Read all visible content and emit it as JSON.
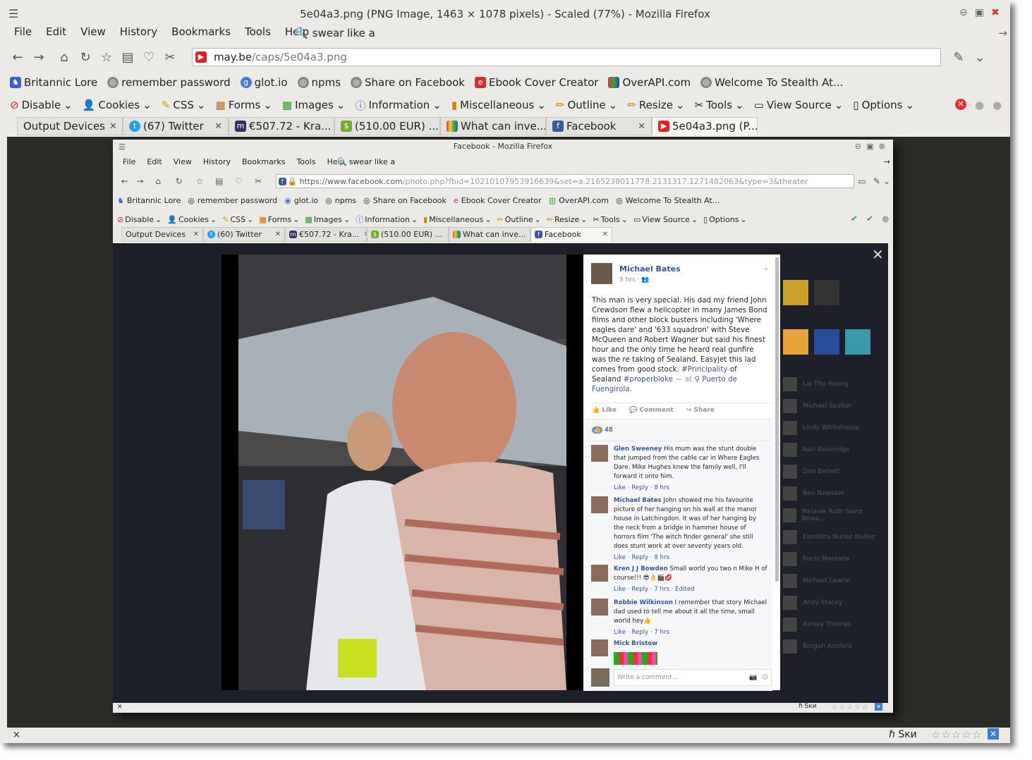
{
  "outer": {
    "title": "5e04a3.png (PNG Image, 1463 × 1078 pixels) - Scaled (77%) - Mozilla Firefox",
    "menu": [
      "File",
      "Edit",
      "View",
      "History",
      "Bookmarks",
      "Tools",
      "Help"
    ],
    "search_value": "swear like a",
    "url": "may.be/caps/5e04a3.png",
    "url_host": "may.be",
    "url_path": "/caps/5e04a3.png",
    "bookmarks": [
      "Britannic Lore",
      "remember password",
      "glot.io",
      "npms",
      "Share on Facebook",
      "Ebook Cover Creator",
      "OverAPI.com",
      "Welcome To Stealth At..."
    ],
    "webdev": [
      "Disable",
      "Cookies",
      "CSS",
      "Forms",
      "Images",
      "Information",
      "Miscellaneous",
      "Outline",
      "Resize",
      "Tools",
      "View Source",
      "Options"
    ],
    "tabs": [
      "Output Devices",
      "(67) Twitter",
      "€507.72 - Kra...",
      "(510.00 EUR) ...",
      "What can inve...",
      "Facebook",
      "5e04a3.png (P..."
    ],
    "status_close": "×",
    "status_logo": "ℏ Ѕки",
    "accent_color": "#365899"
  },
  "inner": {
    "title": "Facebook - Mozilla Firefox",
    "menu": [
      "File",
      "Edit",
      "View",
      "History",
      "Bookmarks",
      "Tools",
      "Help"
    ],
    "search_value": "swear like a",
    "url_host": "https://www.facebook.com",
    "url_path": "/photo.php?fbid=10210107953916639&set=a.2165238011778.2131317.1271482063&type=3&theater",
    "bookmarks": [
      "Britannic Lore",
      "remember password",
      "glot.io",
      "npms",
      "Share on Facebook",
      "Ebook Cover Creator",
      "OverAPI.com",
      "Welcome To Stealth At..."
    ],
    "webdev": [
      "Disable",
      "Cookies",
      "CSS",
      "Forms",
      "Images",
      "Information",
      "Miscellaneous",
      "Outline",
      "Resize",
      "Tools",
      "View Source",
      "Options"
    ],
    "tabs": [
      "Output Devices",
      "(60) Twitter",
      "€507.72 - Kra...",
      "(510.00 EUR) ...",
      "What can inve...",
      "Facebook"
    ],
    "status_logo": "ℏ Ѕки"
  },
  "post": {
    "author": "Michael Bates",
    "time": "9 hrs",
    "body_a": "This man is very special. His dad my friend John Crewdson flew a helicopter in many James Bond films and other block busters including 'Where eagles dare' and '633 squadron' with Steve McQueen and Robert Wagner but said his finest hour and the only time he heard real gunfire was the re taking of Sealand. Easyjet this lad comes from good stock.",
    "hashtag1": "#Principality",
    "body_b": "of Sealand",
    "hashtag2": "#properbloke",
    "at": "— at",
    "place": "Puerto de Fuengirola.",
    "like": "Like",
    "comment": "Comment",
    "share": "Share",
    "likes_count": "48",
    "comments": [
      {
        "name": "Glen Sweeney",
        "text": "His mum was the stunt double that jumped from the cable car in Where Eagles Dare. Mike Hughes knew the family well, I'll forward it onto him.",
        "meta": "Like · Reply · 8 hrs"
      },
      {
        "name": "Michael Bates",
        "text": "John showed me his favourite picture of her hanging on his wall at the manor house in Latchingdon. It was of her hanging by the neck from a bridge in hammer house of horrors film 'The witch finder general' she still does stunt work at over seventy years old.",
        "meta": "Like · Reply · 8 hrs"
      },
      {
        "name": "Kren J J Bowden",
        "text": "Small world you two n Mike H of course!!! 😎👌🎬💋",
        "meta": "Like · Reply · 7 hrs · Edited"
      },
      {
        "name": "Robbie Wilkinson",
        "text": "I remember that story Michael dad used to tell me about it all the time, small world hey👍",
        "meta": "Like · Reply · 7 hrs"
      },
      {
        "name": "Mick Bristow",
        "text": "",
        "meta": ""
      }
    ],
    "comment_placeholder": "Write a comment..."
  },
  "sidebar_names": [
    "Lai Thu Huong",
    "Michael Spalter",
    "Lindy Whitehouse",
    "Nan Beveridge",
    "Dan Barrett",
    "Ben Newsam",
    "Melanie Ruth Sainz Bowa...",
    "Estrellita Nuñez Nuñez",
    "Rocio Montana",
    "Michael Lawrie",
    "Andy Stacey",
    "Ashley Thomas",
    "Brogan Ashford"
  ]
}
